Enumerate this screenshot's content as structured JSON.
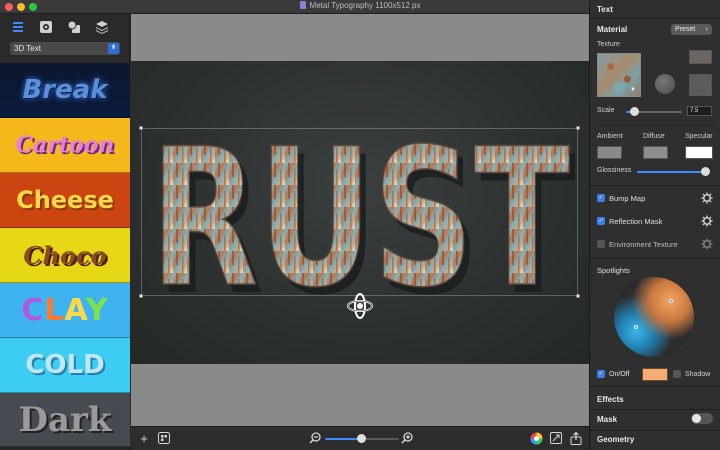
{
  "window": {
    "title": "Metal Typography 1100x512 px"
  },
  "sidebar": {
    "toolbar_icons": [
      "layers-list-icon",
      "gear-icon",
      "shapes-icon",
      "stack-icon"
    ],
    "category_select": "3D Text",
    "presets": [
      {
        "name": "preset-break",
        "label": "Break"
      },
      {
        "name": "preset-cartoon",
        "label": "Cartoon"
      },
      {
        "name": "preset-cheese",
        "label": "Cheese"
      },
      {
        "name": "preset-choco",
        "label": "Choco"
      },
      {
        "name": "preset-clay",
        "label": "CLAY"
      },
      {
        "name": "preset-cold",
        "label": "COLD"
      },
      {
        "name": "preset-dark",
        "label": "Dark"
      }
    ]
  },
  "canvas": {
    "text": "RUST"
  },
  "bottombar": {
    "zoom_level": 0.48,
    "icons": [
      "plus-icon",
      "add-layer-icon",
      "zoom-out-icon",
      "zoom-in-icon",
      "color-wheel-icon",
      "fit-screen-icon",
      "share-icon"
    ]
  },
  "inspector": {
    "header": "Text",
    "material": {
      "title": "Material",
      "preset_button": "Preset",
      "texture_label": "Texture",
      "scale_label": "Scale",
      "scale_value": "7.5",
      "scale_fraction": 0.14,
      "ambient_label": "Ambient",
      "diffuse_label": "Diffuse",
      "specular_label": "Specular",
      "glossiness_label": "Glossiness",
      "glossiness_fraction": 0.97,
      "colors": {
        "ambient": "#8a8a8a",
        "diffuse": "#8e8e8e",
        "specular": "#ffffff"
      }
    },
    "options": [
      {
        "label": "Bump Map",
        "checked": true
      },
      {
        "label": "Reflection Mask",
        "checked": true
      },
      {
        "label": "Environment Texture",
        "checked": false
      }
    ],
    "spotlights": {
      "title": "Spotlights",
      "onoff_label": "On/Off",
      "shadow_label": "Shadow",
      "light_color": "#f5ac74"
    },
    "effects_title": "Effects",
    "mask_title": "Mask",
    "geometry_title": "Geometry"
  }
}
